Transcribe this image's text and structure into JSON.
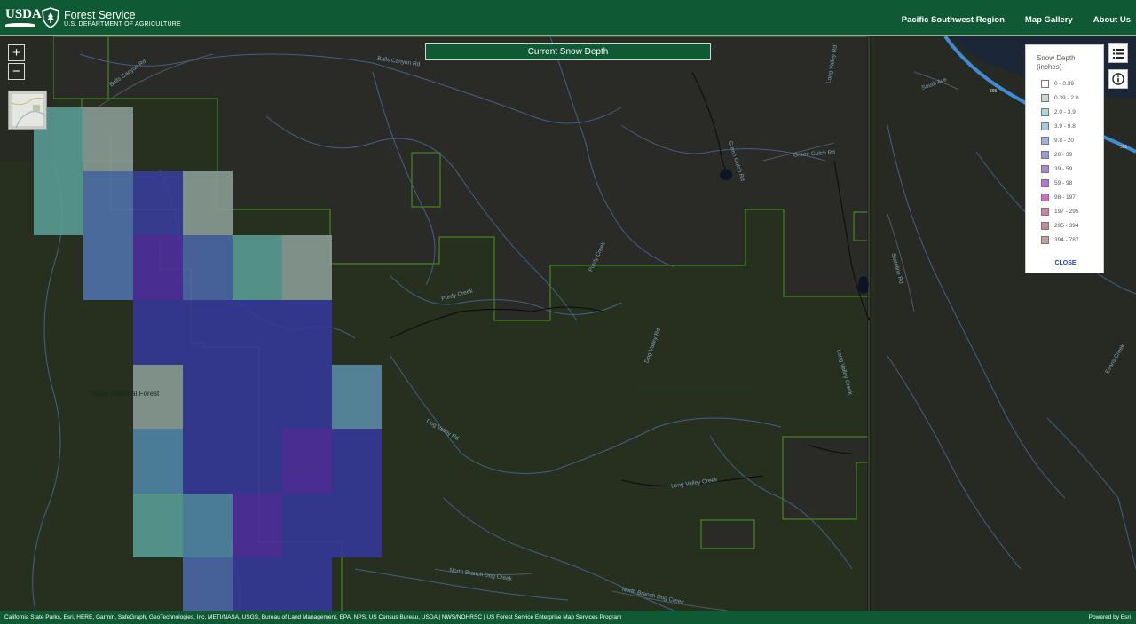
{
  "header": {
    "usda": "USDA",
    "brand_title": "Forest Service",
    "brand_sub": "U.S. DEPARTMENT OF AGRICULTURE",
    "nav": [
      "Pacific Southwest Region",
      "Map Gallery",
      "About Us"
    ]
  },
  "map": {
    "title": "Current Snow Depth",
    "zoom_in": "+",
    "zoom_out": "−",
    "forest_labels": [
      "Tahoe National Forest",
      "Humboldt-Toiyabe National Forest"
    ],
    "road_labels": [
      "Balls Canyon Rd",
      "Balls Canyon Rd",
      "Green Gulch Rd",
      "Green Gulch Rd",
      "Long Valley Rd",
      "South Ave",
      "Purdy Creek",
      "Purdy Creek",
      "Dog Valley Rd",
      "Dog Valley Rd",
      "Long Valley Creek",
      "Long Valley Creek",
      "North Branch Dog Creek",
      "North Branch Dog Creek",
      "Stateline Rd",
      "Evans Creek",
      "395",
      "395"
    ]
  },
  "legend": {
    "title": "Snow Depth (inches)",
    "close": "CLOSE",
    "items": [
      {
        "label": "0 - 0.39",
        "color": "#ffffff"
      },
      {
        "label": "0.39 - 2.0",
        "color": "#c9d8cf"
      },
      {
        "label": "2.0 - 3.9",
        "color": "#a9d6d8"
      },
      {
        "label": "3.9 - 9.8",
        "color": "#a9c7e0"
      },
      {
        "label": "9.8 - 20",
        "color": "#9fb0e2"
      },
      {
        "label": "20 - 39",
        "color": "#9a98e2"
      },
      {
        "label": "39 - 59",
        "color": "#a787df"
      },
      {
        "label": "59 - 98",
        "color": "#b873d8"
      },
      {
        "label": "98 - 197",
        "color": "#d36bc7"
      },
      {
        "label": "197 - 295",
        "color": "#d17fab"
      },
      {
        "label": "295 - 394",
        "color": "#c3899c"
      },
      {
        "label": "394 - 787",
        "color": "#c79e99"
      }
    ]
  },
  "attribution": {
    "left": "California State Parks, Esri, HERE, Garmin, SafeGraph, GeoTechnologies, Inc, METI/NASA, USGS, Bureau of Land Management, EPA, NPS, US Census Bureau, USDA | NWS/NOHRSC | US Forest Service Enterprise Map Services Program",
    "right": "Powered by Esri"
  },
  "colors": {
    "header": "#0f5a34",
    "map_bg": "#262a22",
    "forest": "#27301f",
    "water": "#4d6f98",
    "highway": "#3f8bd6"
  },
  "icons": [
    "layer-list-icon",
    "info-icon",
    "forest-service-shield-icon"
  ]
}
